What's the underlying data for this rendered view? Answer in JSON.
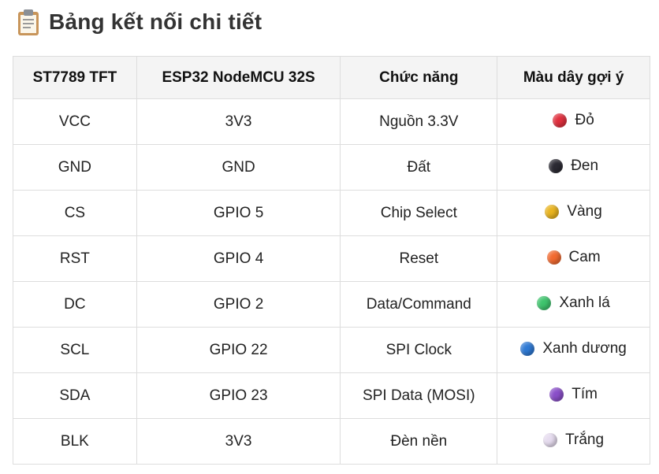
{
  "title": "Bảng kết nối chi tiết",
  "headers": [
    "ST7789 TFT",
    "ESP32 NodeMCU 32S",
    "Chức năng",
    "Màu dây gợi ý"
  ],
  "rows": [
    {
      "tft": "VCC",
      "esp": "3V3",
      "func": "Nguồn 3.3V",
      "wire": "Đỏ",
      "color": "#e0303e"
    },
    {
      "tft": "GND",
      "esp": "GND",
      "func": "Đất",
      "wire": "Đen",
      "color": "#2b2a33"
    },
    {
      "tft": "CS",
      "esp": "GPIO 5",
      "func": "Chip Select",
      "wire": "Vàng",
      "color": "#e9b420"
    },
    {
      "tft": "RST",
      "esp": "GPIO 4",
      "func": "Reset",
      "wire": "Cam",
      "color": "#f26a30"
    },
    {
      "tft": "DC",
      "esp": "GPIO 2",
      "func": "Data/Command",
      "wire": "Xanh lá",
      "color": "#3ec46d"
    },
    {
      "tft": "SCL",
      "esp": "GPIO 22",
      "func": "SPI Clock",
      "wire": "Xanh dương",
      "color": "#2e79d4"
    },
    {
      "tft": "SDA",
      "esp": "GPIO 23",
      "func": "SPI Data (MOSI)",
      "wire": "Tím",
      "color": "#8a4fc9"
    },
    {
      "tft": "BLK",
      "esp": "3V3",
      "func": "Đèn nền",
      "wire": "Trắng",
      "color": "#e6dcef"
    }
  ]
}
